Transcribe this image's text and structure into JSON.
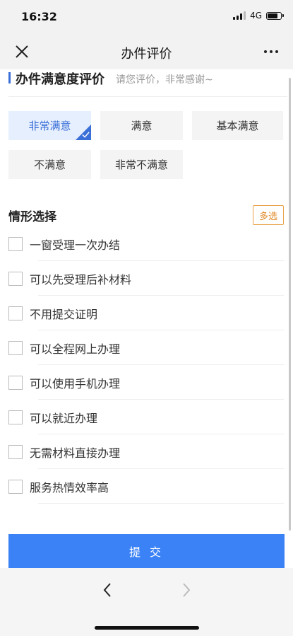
{
  "status_bar": {
    "time": "16:32",
    "network": "4G"
  },
  "nav": {
    "title": "办件评价"
  },
  "rating": {
    "title": "办件满意度评价",
    "hint": "请您评价，非常感谢~",
    "options": [
      "非常满意",
      "满意",
      "基本满意",
      "不满意",
      "非常不满意"
    ],
    "selected": "非常满意"
  },
  "situations": {
    "title": "情形选择",
    "badge": "多选",
    "items": [
      "一窗受理一次办结",
      "可以先受理后补材料",
      "不用提交证明",
      "可以全程网上办理",
      "可以使用手机办理",
      "可以就近办理",
      "无需材料直接办理",
      "服务热情效率高"
    ]
  },
  "submit_label": "提 交",
  "colors": {
    "accent": "#3a6fd8",
    "submit": "#3b82f6",
    "badge": "#e08a2a"
  }
}
